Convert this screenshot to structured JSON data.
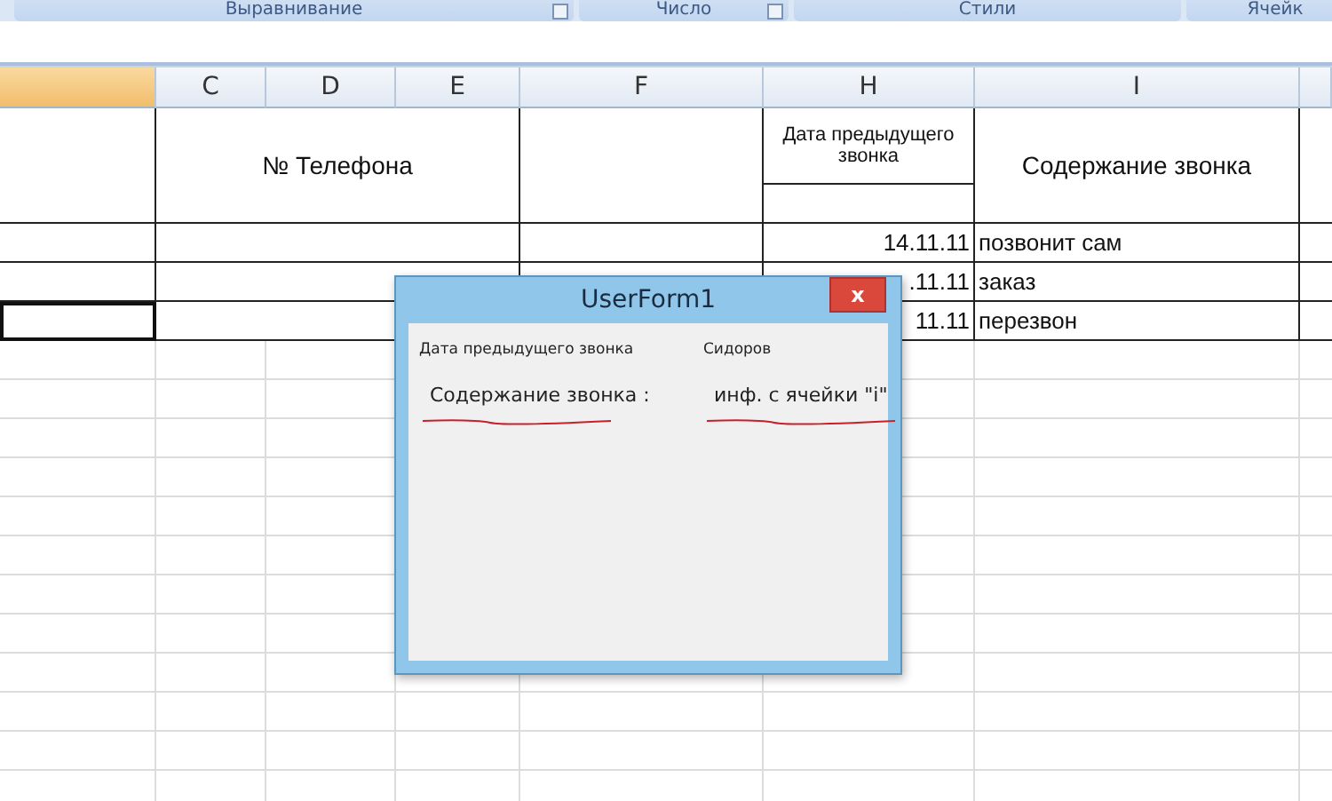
{
  "ribbon_groups": [
    {
      "label": "Выравнивание",
      "launcher": true
    },
    {
      "label": "Число",
      "launcher": true
    },
    {
      "label": "Стили",
      "launcher": false
    },
    {
      "label": "Ячейк",
      "launcher": false
    }
  ],
  "columns": [
    {
      "selected": true
    },
    {
      "label": "C",
      "selected": false
    },
    {
      "label": "D",
      "selected": false
    },
    {
      "label": "E",
      "selected": false
    },
    {
      "label": "F",
      "selected": false
    },
    {
      "label": "H",
      "selected": false
    },
    {
      "label": "I",
      "selected": false
    },
    {
      "selected": false
    }
  ],
  "header": {
    "phone": "№ Телефона",
    "prev_date": "Дата предыдущего звонка",
    "content": "Содержание звонка"
  },
  "rows": [
    {
      "date": "14.11.11",
      "content": "позвонит сам",
      "selected": false
    },
    {
      "date": ".11.11",
      "content": "заказ",
      "selected": false
    },
    {
      "date": "11.11",
      "content": "перезвон",
      "selected": true
    }
  ],
  "dialog": {
    "title": "UserForm1",
    "close": "x",
    "labels": [
      {
        "text": "Дата предыдущего звонка",
        "kind": "note",
        "underlined": false
      },
      {
        "text": "Сидоров",
        "kind": "note",
        "underlined": false
      },
      {
        "text": "Содержание звонка :",
        "kind": "field",
        "underlined": true
      },
      {
        "text": "инф. с ячейки \"i\"",
        "kind": "field",
        "underlined": true
      }
    ]
  }
}
